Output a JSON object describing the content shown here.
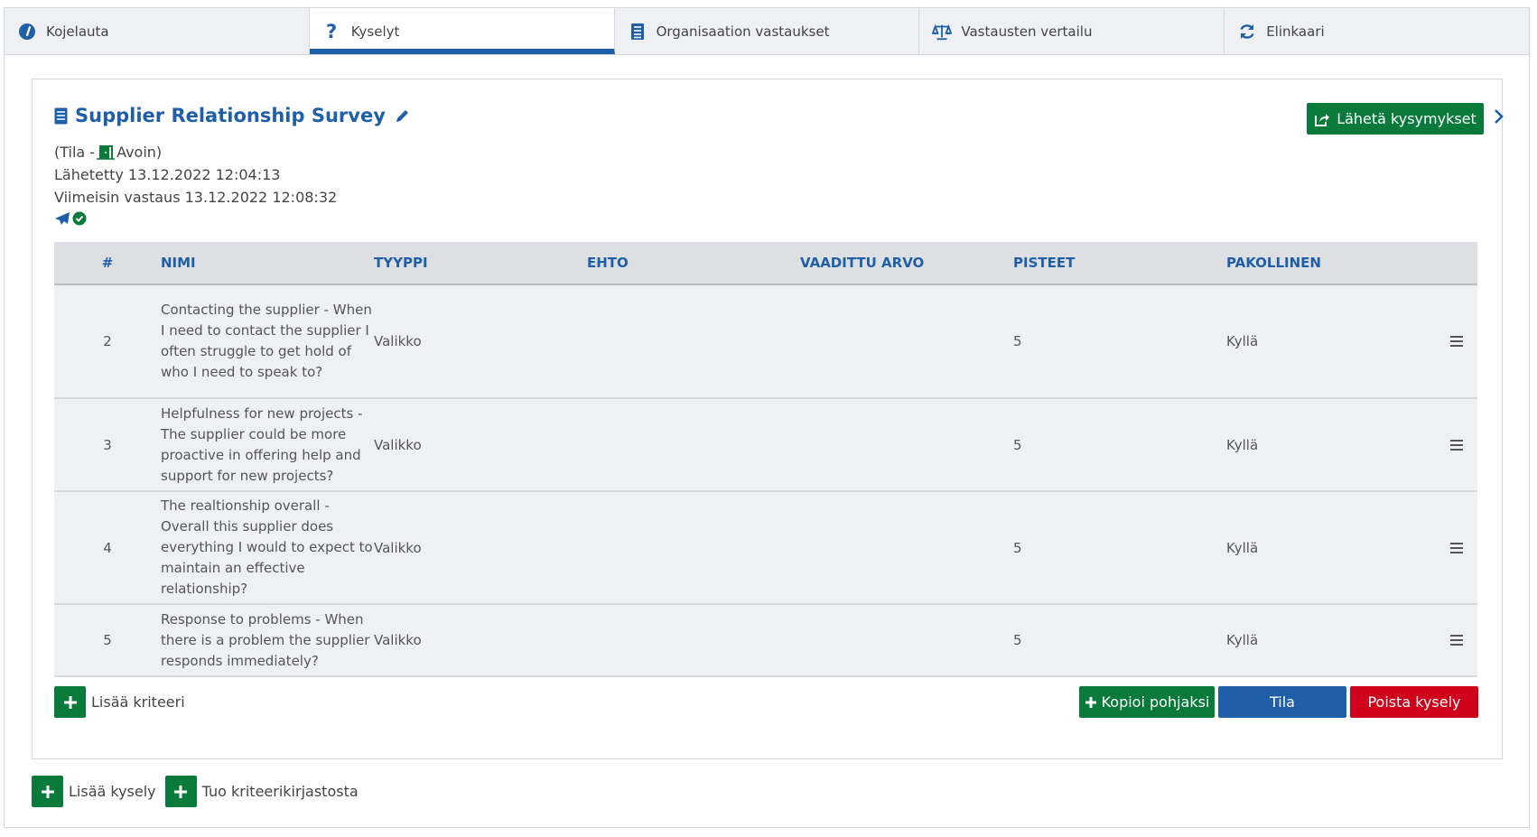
{
  "tabs": [
    {
      "label": "Kojelauta",
      "icon": "dashboard-icon"
    },
    {
      "label": "Kyselyt",
      "icon": "question-icon"
    },
    {
      "label": "Organisaation vastaukset",
      "icon": "list-icon"
    },
    {
      "label": "Vastausten vertailu",
      "icon": "balance-scale-icon"
    },
    {
      "label": "Elinkaari",
      "icon": "refresh-icon"
    }
  ],
  "survey": {
    "title": "Supplier Relationship Survey",
    "status_prefix": "(Tila -",
    "status_value": "Avoin)",
    "sent": "Lähetetty 13.12.2022 12:04:13",
    "last_response": "Viimeisin vastaus 13.12.2022 12:08:32",
    "send_label": "Lähetä kysymykset"
  },
  "table": {
    "headers": {
      "num": "#",
      "name": "NIMI",
      "type": "TYYPPI",
      "condition": "EHTO",
      "required": "VAADITTU ARVO",
      "points": "PISTEET",
      "mandatory": "PAKOLLINEN"
    },
    "rows": [
      {
        "num": "2",
        "name": "Contacting the supplier - When I need to contact the supplier I often struggle to get hold of who I need to speak to?",
        "type": "Valikko",
        "condition": "",
        "required": "",
        "points": "5",
        "mandatory": "Kyllä"
      },
      {
        "num": "3",
        "name": "Helpfulness for new projects - The supplier could be more proactive in offering help and support for new projects?",
        "type": "Valikko",
        "condition": "",
        "required": "",
        "points": "5",
        "mandatory": "Kyllä"
      },
      {
        "num": "4",
        "name": "The realtionship overall - Overall this supplier does everything I would to expect to maintain an effective relationship?",
        "type": "Valikko",
        "condition": "",
        "required": "",
        "points": "5",
        "mandatory": "Kyllä"
      },
      {
        "num": "5",
        "name": "Response to problems - When there is a problem the supplier responds immediately?",
        "type": "Valikko",
        "condition": "",
        "required": "",
        "points": "5",
        "mandatory": "Kyllä"
      }
    ]
  },
  "actions": {
    "add_criterion": "Lisää kriteeri",
    "copy_template": "Kopioi pohjaksi",
    "status": "Tila",
    "delete_survey": "Poista kysely",
    "add_survey": "Lisää kysely",
    "import_library": "Tuo kriteerikirjastosta"
  },
  "colors": {
    "primary": "#1f5fa8",
    "success": "#0a7a3a",
    "danger": "#d0021b"
  }
}
